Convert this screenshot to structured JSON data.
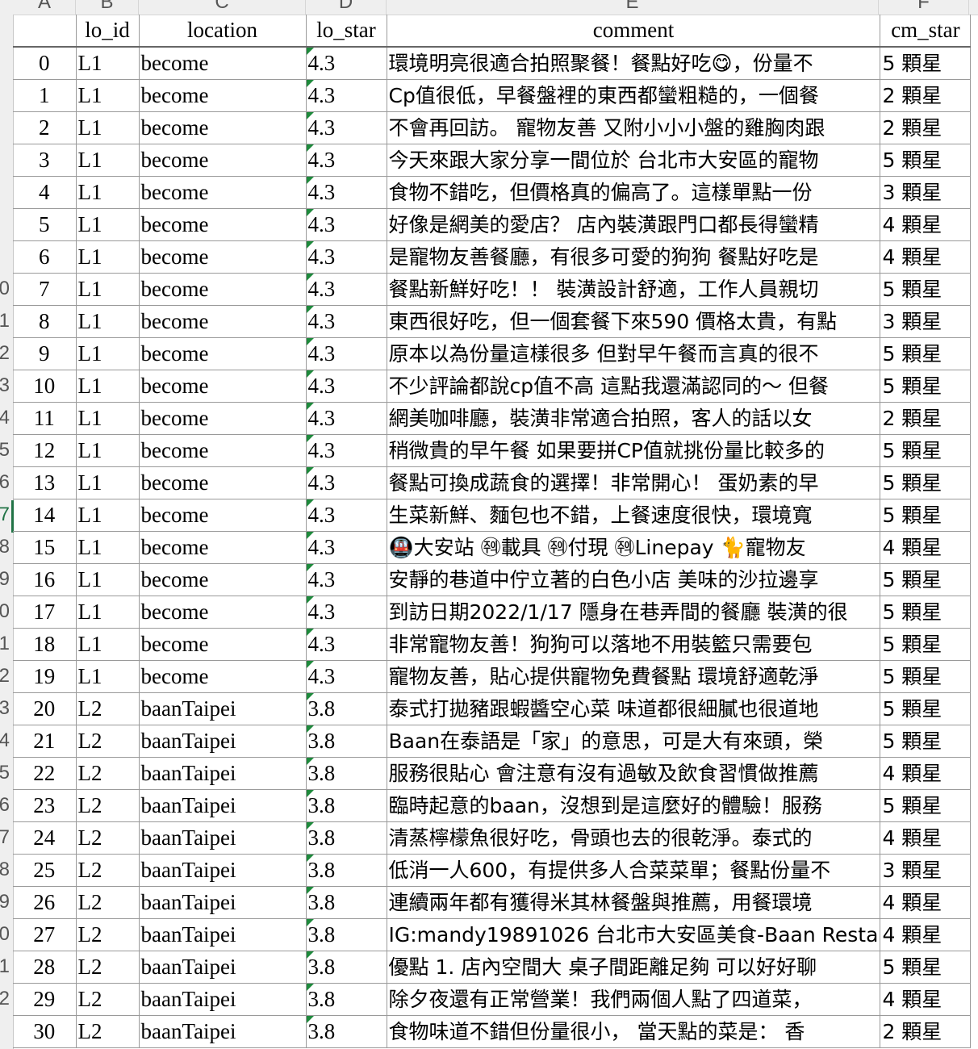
{
  "column_letters": [
    "A",
    "B",
    "C",
    "D",
    "E",
    "F"
  ],
  "headers": {
    "index": "",
    "lo_id": "lo_id",
    "location": "location",
    "lo_star": "lo_star",
    "comment": "comment",
    "cm_star": "cm_star"
  },
  "row_header_partial": [
    "",
    "",
    "",
    "",
    "",
    "",
    "",
    "",
    "0",
    "1",
    "2",
    "3",
    "4",
    "5",
    "6",
    "7",
    "8",
    "9",
    "0",
    "1",
    "2",
    "3",
    "4",
    "5",
    "6",
    "7",
    "8",
    "9",
    "0",
    "1",
    "2"
  ],
  "selected_row_number": 6,
  "rows": [
    {
      "index": "0",
      "lo_id": "L1",
      "location": "become",
      "lo_star": "4.3",
      "comment": "環境明亮很適合拍照聚餐！餐點好吃😋，份量不",
      "cm_star": "5 顆星"
    },
    {
      "index": "1",
      "lo_id": "L1",
      "location": "become",
      "lo_star": "4.3",
      "comment": "Cp值很低，早餐盤裡的東西都蠻粗糙的，一個餐",
      "cm_star": "2 顆星"
    },
    {
      "index": "2",
      "lo_id": "L1",
      "location": "become",
      "lo_star": "4.3",
      "comment": "不會再回訪。 寵物友善 又附小小小盤的雞胸肉跟",
      "cm_star": "2 顆星"
    },
    {
      "index": "3",
      "lo_id": "L1",
      "location": "become",
      "lo_star": "4.3",
      "comment": "今天來跟大家分享一間位於 台北市大安區的寵物",
      "cm_star": "5 顆星"
    },
    {
      "index": "4",
      "lo_id": "L1",
      "location": "become",
      "lo_star": "4.3",
      "comment": "食物不錯吃，但價格真的偏高了。這樣單點一份",
      "cm_star": "3 顆星"
    },
    {
      "index": "5",
      "lo_id": "L1",
      "location": "become",
      "lo_star": "4.3",
      "comment": "好像是網美的愛店？ 店內裝潢跟門口都長得蠻精",
      "cm_star": "4 顆星"
    },
    {
      "index": "6",
      "lo_id": "L1",
      "location": "become",
      "lo_star": "4.3",
      "comment": "是寵物友善餐廳，有很多可愛的狗狗 餐點好吃是",
      "cm_star": "4 顆星"
    },
    {
      "index": "7",
      "lo_id": "L1",
      "location": "become",
      "lo_star": "4.3",
      "comment": "餐點新鮮好吃！！ 裝潢設計舒適，工作人員親切",
      "cm_star": "5 顆星"
    },
    {
      "index": "8",
      "lo_id": "L1",
      "location": "become",
      "lo_star": "4.3",
      "comment": "東西很好吃，但一個套餐下來590 價格太貴，有點",
      "cm_star": "3 顆星"
    },
    {
      "index": "9",
      "lo_id": "L1",
      "location": "become",
      "lo_star": "4.3",
      "comment": "原本以為份量這樣很多 但對早午餐而言真的很不",
      "cm_star": "5 顆星"
    },
    {
      "index": "10",
      "lo_id": "L1",
      "location": "become",
      "lo_star": "4.3",
      "comment": "不少評論都說cp值不高 這點我還滿認同的～ 但餐",
      "cm_star": "5 顆星"
    },
    {
      "index": "11",
      "lo_id": "L1",
      "location": "become",
      "lo_star": "4.3",
      "comment": "網美咖啡廳，裝潢非常適合拍照，客人的話以女",
      "cm_star": "2 顆星"
    },
    {
      "index": "12",
      "lo_id": "L1",
      "location": "become",
      "lo_star": "4.3",
      "comment": "稍微貴的早午餐 如果要拼CP值就挑份量比較多的",
      "cm_star": "5 顆星"
    },
    {
      "index": "13",
      "lo_id": "L1",
      "location": "become",
      "lo_star": "4.3",
      "comment": "餐點可換成蔬食的選擇！非常開心！ 蛋奶素的早",
      "cm_star": "5 顆星"
    },
    {
      "index": "14",
      "lo_id": "L1",
      "location": "become",
      "lo_star": "4.3",
      "comment": "生菜新鮮、麵包也不錯，上餐速度很快，環境寬",
      "cm_star": "5 顆星"
    },
    {
      "index": "15",
      "lo_id": "L1",
      "location": "become",
      "lo_star": "4.3",
      "comment": "🚇大安站 ㉽載具 ㉽付現 ㉽Linepay 🐈寵物友",
      "cm_star": "4 顆星"
    },
    {
      "index": "16",
      "lo_id": "L1",
      "location": "become",
      "lo_star": "4.3",
      "comment": "安靜的巷道中佇立著的白色小店 美味的沙拉邊享",
      "cm_star": "5 顆星"
    },
    {
      "index": "17",
      "lo_id": "L1",
      "location": "become",
      "lo_star": "4.3",
      "comment": "到訪日期2022/1/17 隱身在巷弄間的餐廳 裝潢的很",
      "cm_star": "5 顆星"
    },
    {
      "index": "18",
      "lo_id": "L1",
      "location": "become",
      "lo_star": "4.3",
      "comment": "非常寵物友善！狗狗可以落地不用裝籃只需要包",
      "cm_star": "5 顆星"
    },
    {
      "index": "19",
      "lo_id": "L1",
      "location": "become",
      "lo_star": "4.3",
      "comment": "寵物友善，貼心提供寵物免費餐點 環境舒適乾淨",
      "cm_star": "5 顆星"
    },
    {
      "index": "20",
      "lo_id": "L2",
      "location": "baanTaipei",
      "lo_star": "3.8",
      "comment": "泰式打拋豬跟蝦醬空心菜 味道都很細膩也很道地",
      "cm_star": "5 顆星"
    },
    {
      "index": "21",
      "lo_id": "L2",
      "location": "baanTaipei",
      "lo_star": "3.8",
      "comment": "Baan在泰語是「家」的意思，可是大有來頭，榮",
      "cm_star": "5 顆星"
    },
    {
      "index": "22",
      "lo_id": "L2",
      "location": "baanTaipei",
      "lo_star": "3.8",
      "comment": "服務很貼心 會注意有沒有過敏及飲食習慣做推薦",
      "cm_star": "4 顆星"
    },
    {
      "index": "23",
      "lo_id": "L2",
      "location": "baanTaipei",
      "lo_star": "3.8",
      "comment": "臨時起意的baan，沒想到是這麼好的體驗！服務",
      "cm_star": "5 顆星"
    },
    {
      "index": "24",
      "lo_id": "L2",
      "location": "baanTaipei",
      "lo_star": "3.8",
      "comment": "清蒸檸檬魚很好吃，骨頭也去的很乾淨。泰式的",
      "cm_star": "4 顆星"
    },
    {
      "index": "25",
      "lo_id": "L2",
      "location": "baanTaipei",
      "lo_star": "3.8",
      "comment": "低消一人600，有提供多人合菜菜單；餐點份量不",
      "cm_star": "3 顆星"
    },
    {
      "index": "26",
      "lo_id": "L2",
      "location": "baanTaipei",
      "lo_star": "3.8",
      "comment": "連續兩年都有獲得米其林餐盤與推薦，用餐環境",
      "cm_star": "4 顆星"
    },
    {
      "index": "27",
      "lo_id": "L2",
      "location": "baanTaipei",
      "lo_star": "3.8",
      "comment": "IG:mandy19891026 台北市大安區美食-Baan Resta",
      "cm_star": "4 顆星"
    },
    {
      "index": "28",
      "lo_id": "L2",
      "location": "baanTaipei",
      "lo_star": "3.8",
      "comment": "優點 1. 店內空間大 桌子間距離足夠 可以好好聊",
      "cm_star": "5 顆星"
    },
    {
      "index": "29",
      "lo_id": "L2",
      "location": "baanTaipei",
      "lo_star": "3.8",
      "comment": "除夕夜還有正常營業！我們兩個人點了四道菜，",
      "cm_star": "4 顆星"
    },
    {
      "index": "30",
      "lo_id": "L2",
      "location": "baanTaipei",
      "lo_star": "3.8",
      "comment": "食物味道不錯但份量很小， 當天點的菜是： 香",
      "cm_star": "2 顆星"
    }
  ]
}
